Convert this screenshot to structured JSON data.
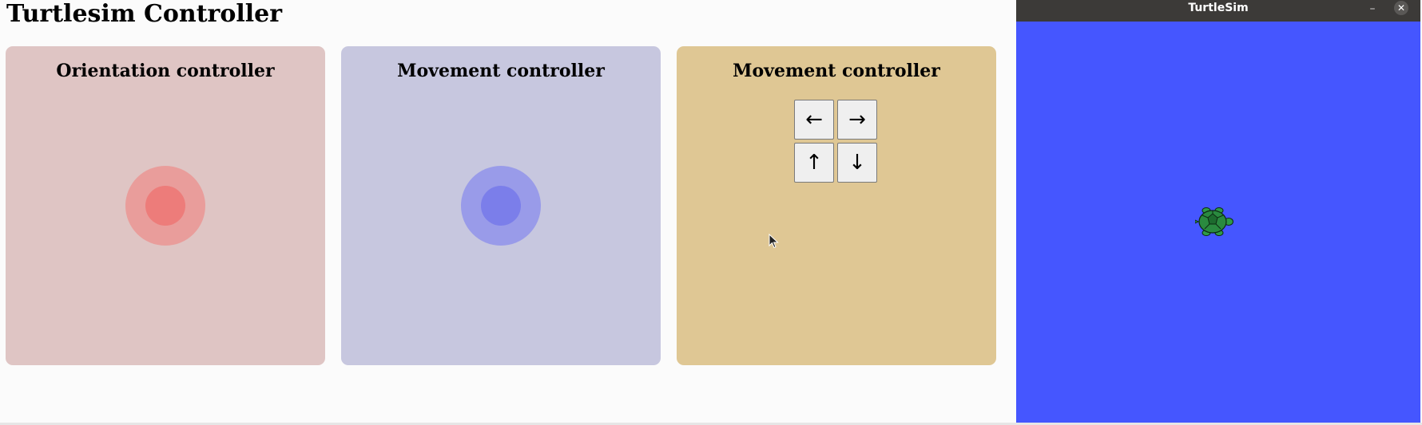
{
  "page": {
    "title": "Turtlesim Controller"
  },
  "panels": [
    {
      "title": "Orientation controller",
      "bg": "#dfc5c4",
      "outer": "#e99d9b",
      "inner": "#ed7c7a"
    },
    {
      "title": "Movement controller",
      "bg": "#c7c7df",
      "outer": "#999be9",
      "inner": "#7b7eea"
    },
    {
      "title": "Movement controller",
      "bg": "#dfc794",
      "buttons": {
        "left": "←",
        "right": "→",
        "up": "↑",
        "down": "↓"
      }
    }
  ],
  "sim": {
    "title": "TurtleSim",
    "bg": "#4556ff",
    "minimize_icon": "–",
    "close_icon": "✕"
  },
  "icons": {
    "cursor": "mouse-cursor-icon",
    "turtle": "turtle-icon"
  }
}
